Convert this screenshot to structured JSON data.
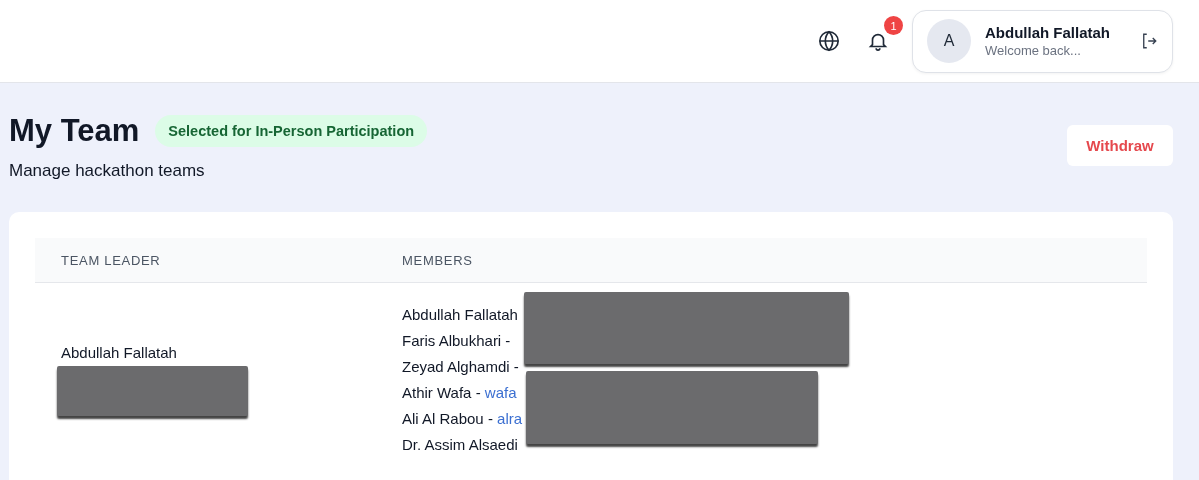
{
  "header": {
    "notifications": {
      "count": "1"
    },
    "user": {
      "avatar": "A",
      "name": "Abdullah Fallatah",
      "subtitle": "Welcome back..."
    }
  },
  "page": {
    "title": "My Team",
    "status_badge": "Selected for In-Person Participation",
    "subtitle": "Manage hackathon teams",
    "withdraw_button": "Withdraw"
  },
  "table": {
    "columns": [
      "TEAM LEADER",
      "MEMBERS"
    ],
    "rows": [
      {
        "leader": {
          "name": "Abdullah Fallatah",
          "redacted": true
        },
        "members": [
          {
            "name": "Abdullah Fallatah"
          },
          {
            "name": "Faris Albukhari -"
          },
          {
            "name": "Zeyad Alghamdi -"
          },
          {
            "name": "Athir Wafa - ",
            "email": "wafa"
          },
          {
            "name": "Ali Al Rabou - ",
            "email": "alra"
          },
          {
            "name": "Dr. Assim Alsaedi"
          }
        ]
      }
    ]
  }
}
